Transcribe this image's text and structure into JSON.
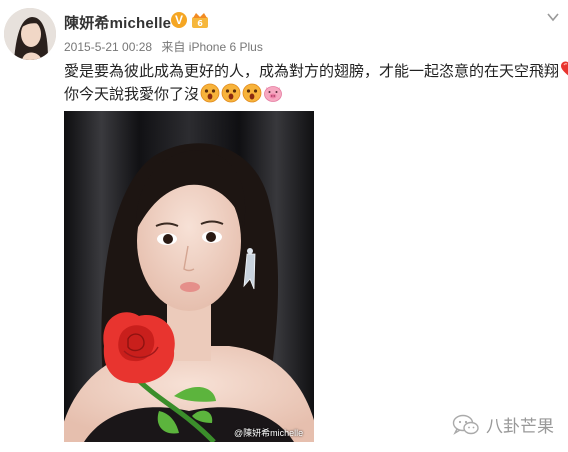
{
  "post": {
    "username": "陳妍希michelle",
    "verified_badge": "V",
    "timestamp": "2015-5-21 00:28",
    "source_prefix": "来自",
    "source": "iPhone 6 Plus",
    "text_line1": "愛是要為彼此成為更好的人，成為對方的翅膀，才能一起恣意的在天空飛翔",
    "text_line1_tail": "~",
    "text_line2": "你今天說我愛你了沒",
    "emoticons_line1": [
      "heart-icon"
    ],
    "emoticons_line2": [
      "surprised-face-icon",
      "surprised-face-icon",
      "surprised-face-icon",
      "pig-face-icon"
    ]
  },
  "image": {
    "watermark": "@陳妍希michelle"
  },
  "brand": {
    "name": "八卦芒果",
    "icon": "wechat-icon"
  },
  "colors": {
    "verified": "#f5a623",
    "heart": "#e8342f",
    "emoji_face": "#f7b33b",
    "pig": "#f6a8c0"
  }
}
